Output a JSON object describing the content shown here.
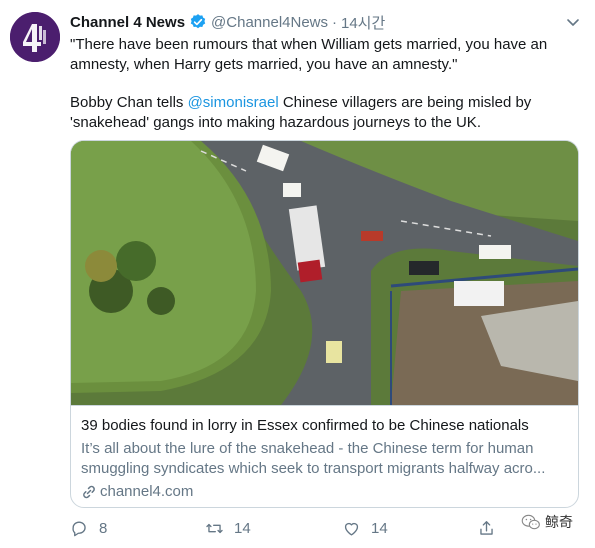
{
  "author": {
    "name": "Channel 4 News",
    "handle": "@Channel4News",
    "dot": "·",
    "time": "14시간"
  },
  "tweet": {
    "line1": "\"There have been rumours that when William gets married, you have an amnesty, when Harry gets married, you have an amnesty.\"",
    "line2_prefix": "Bobby Chan tells ",
    "line2_mention": "@simonisrael",
    "line2_suffix": " Chinese villagers are being misled by 'snakehead' gangs into making hazardous journeys to the UK."
  },
  "card": {
    "title": "39 bodies found in lorry in Essex confirmed to be Chinese nationals",
    "description_line1": "It’s all about the lure of the snakehead - the Chinese term for human",
    "description_line2": "smuggling syndicates which seek to transport migrants halfway acro...",
    "domain": "channel4.com"
  },
  "actions": {
    "reply_count": "8",
    "retweet_count": "14",
    "like_count": "14"
  },
  "watermark": {
    "text": "鲸奇"
  },
  "colors": {
    "link": "#1b95e0",
    "secondary_text": "#657786",
    "avatar_bg": "#4b1e6e",
    "verified": "#1da1f2"
  },
  "icons": [
    "channel4-logo-icon",
    "verified-badge-icon",
    "chevron-down-icon",
    "link-icon",
    "reply-icon",
    "retweet-icon",
    "like-icon",
    "share-icon",
    "wechat-icon"
  ]
}
